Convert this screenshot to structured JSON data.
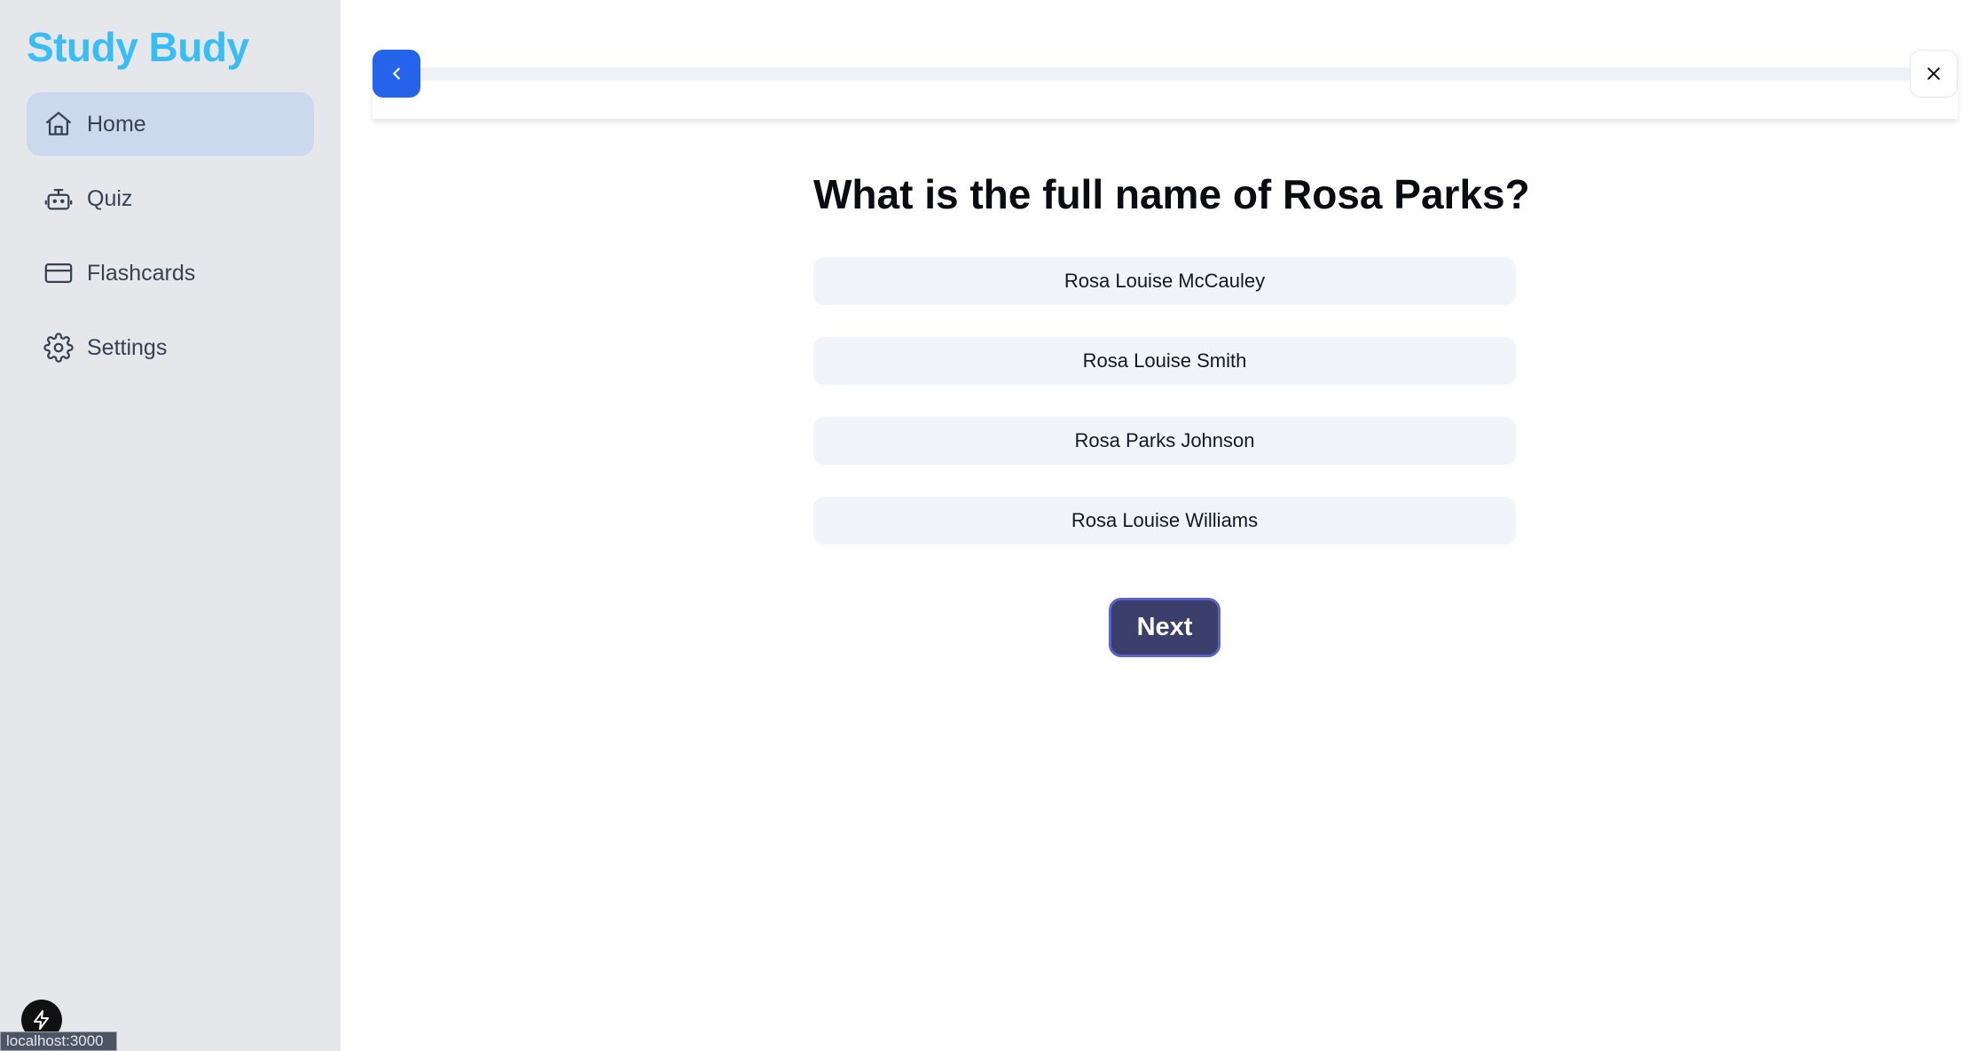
{
  "app": {
    "brand": "Study Budy"
  },
  "sidebar": {
    "items": [
      {
        "label": "Home",
        "icon": "home-icon",
        "active": true
      },
      {
        "label": "Quiz",
        "icon": "robot-icon",
        "active": false
      },
      {
        "label": "Flashcards",
        "icon": "card-icon",
        "active": false
      },
      {
        "label": "Settings",
        "icon": "gear-icon",
        "active": false
      }
    ]
  },
  "footer": {
    "url_tooltip": "localhost:3000",
    "dev_badge_icon": "bolt-icon"
  },
  "topbar": {
    "back_icon": "chevron-left-icon",
    "close_icon": "close-icon",
    "progress": 0
  },
  "quiz": {
    "question": "What is the full name of Rosa Parks?",
    "options": [
      "Rosa Louise McCauley",
      "Rosa Louise Smith",
      "Rosa Parks Johnson",
      "Rosa Louise Williams"
    ],
    "next_label": "Next"
  },
  "colors": {
    "brand": "#38bdf8",
    "primary": "#2563eb",
    "sidebar_bg": "#e5e7eb",
    "active_item_bg": "#cbd8ee",
    "next_button_bg": "#3b3f6b",
    "option_bg": "#f1f4f8"
  }
}
